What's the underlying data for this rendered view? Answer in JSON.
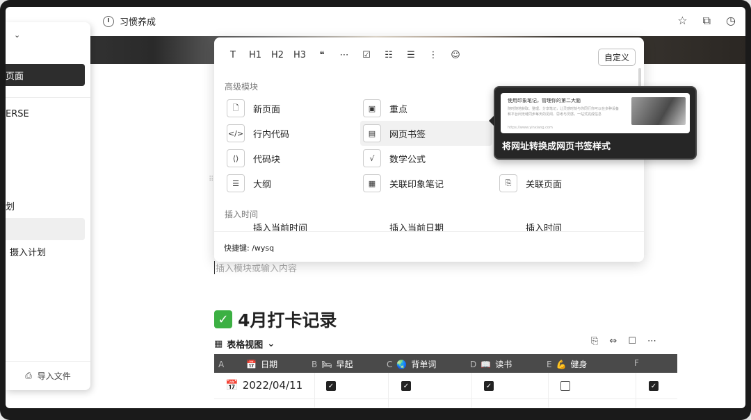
{
  "header": {
    "title": "习惯养成"
  },
  "top_actions": [
    "☆",
    "⧉",
    "◷"
  ],
  "sidebar": {
    "items": [
      {
        "label": "页面"
      },
      {
        "label": "ERSE"
      },
      {
        "label": "划"
      },
      {
        "label": ""
      },
      {
        "label": "摄入计划"
      }
    ],
    "import_label": "导入文件"
  },
  "menu": {
    "format_buttons": [
      "T",
      "H1",
      "H2",
      "H3",
      "❝",
      "⋯",
      "☑",
      "☷",
      "☰",
      "⋮",
      "☺"
    ],
    "custom_label": "自定义",
    "advanced_section": "高级模块",
    "options": [
      {
        "label": "新页面",
        "icon": "🗋"
      },
      {
        "label": "行内代码",
        "icon": "</>"
      },
      {
        "label": "代码块",
        "icon": "⟨⟩"
      },
      {
        "label": "大纲",
        "icon": "☰"
      },
      {
        "label": "重点",
        "icon": "▣"
      },
      {
        "label": "网页书签",
        "icon": "▤"
      },
      {
        "label": "数学公式",
        "icon": "√"
      },
      {
        "label": "关联印象笔记",
        "icon": "▦"
      },
      {
        "label": "关联页面",
        "icon": "⎘"
      }
    ],
    "time_section": "插入时间",
    "time_options": [
      "插入当前时间",
      "插入当前日期",
      "插入时间"
    ],
    "shortcut": "快捷键: /wysq"
  },
  "tooltip": {
    "card_title": "使用印象笔记，管理你的第二大脑",
    "card_desc": "随时随地获取、整理、分享笔记，让灵感时刻与你同行你可以在多种设备和平台间无缝同步每天的见闻、思考与灵感，一站式完成信息",
    "card_url": "https://www.yinxiang.com",
    "caption": "将网址转换成网页书签样式"
  },
  "editor": {
    "placeholder": "插入模块或输入内容",
    "heading": "4月打卡记录",
    "view_label": "表格视图"
  },
  "table": {
    "columns": [
      {
        "key": "A",
        "label": "日期",
        "icon": "📅"
      },
      {
        "key": "B",
        "label": "早起",
        "icon": "🛏"
      },
      {
        "key": "C",
        "label": "背单词",
        "icon": "🌏"
      },
      {
        "key": "D",
        "label": "读书",
        "icon": "📖"
      },
      {
        "key": "E",
        "label": "健身",
        "icon": "💪"
      },
      {
        "key": "F",
        "label": "",
        "icon": ""
      }
    ],
    "rows": [
      {
        "date": "2022/04/11",
        "checks": [
          true,
          true,
          true,
          false,
          true
        ]
      }
    ]
  }
}
